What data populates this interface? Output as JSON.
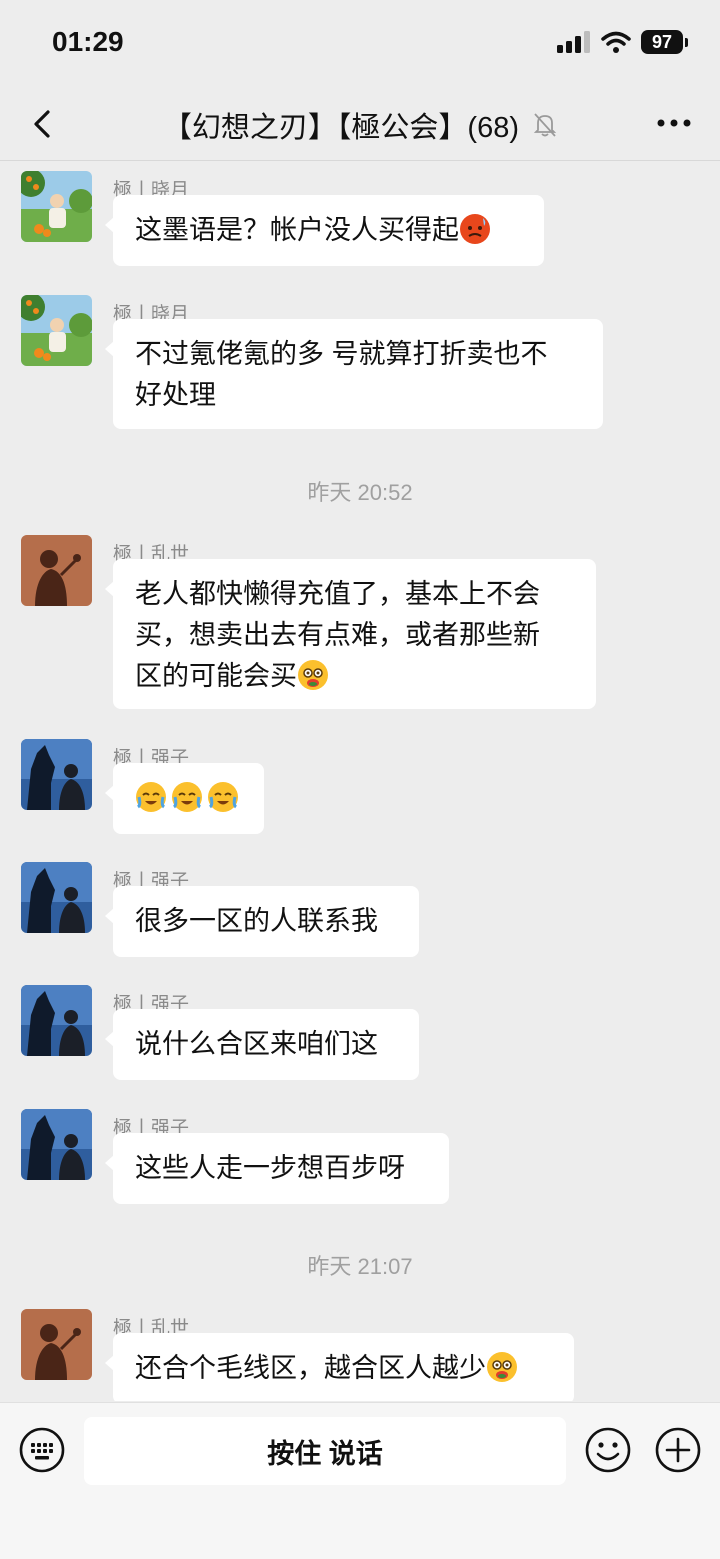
{
  "status": {
    "time": "01:29",
    "battery": "97"
  },
  "header": {
    "title": "【幻想之刃】【極公会】(68)"
  },
  "messages": [
    {
      "sender": "極丨晓月",
      "text": "这墨语是？帐户没人买得起"
    },
    {
      "sender": "極丨晓月",
      "text_line1": "不过氪佬氪的多 号就算打折卖也不",
      "text_line2": "好处理"
    },
    {
      "sender": "極丨乱世",
      "text_line1": "老人都快懒得充值了，基本上不会",
      "text_line2": "买，想卖出去有点难，或者那些新",
      "text_line3": "区的可能会买"
    },
    {
      "sender": "極丨强子"
    },
    {
      "sender": "極丨强子",
      "text": "很多一区的人联系我"
    },
    {
      "sender": "極丨强子",
      "text": "说什么合区来咱们这"
    },
    {
      "sender": "極丨强子",
      "text": "这些人走一步想百步呀"
    },
    {
      "sender": "極丨乱世",
      "text": "还合个毛线区，越合区人越少"
    }
  ],
  "timestamps": [
    "昨天 20:52",
    "昨天 21:07"
  ],
  "input": {
    "talk_label": "按住 说话"
  },
  "colors": {
    "background": "#ededed",
    "bubble": "#ffffff",
    "meta": "#8a8a8a"
  },
  "icons": [
    "back-icon",
    "mute-icon",
    "more-icon",
    "keyboard-icon",
    "emoji-icon",
    "plus-icon",
    "signal-icon",
    "wifi-icon",
    "battery-icon"
  ]
}
